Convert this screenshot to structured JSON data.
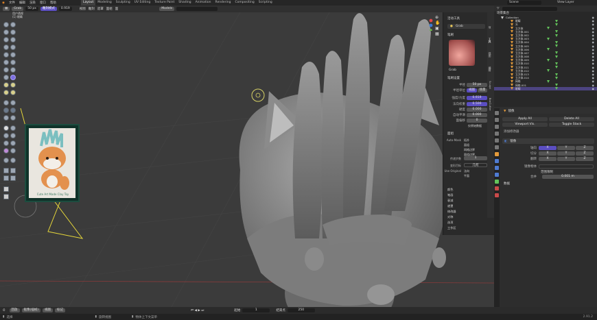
{
  "topbar": {
    "menus": [
      "文件",
      "编辑",
      "渲染",
      "窗口",
      "帮助"
    ],
    "workspaces": [
      "Layout",
      "Modeling",
      "Sculpting",
      "UV Editing",
      "Texture Paint",
      "Shading",
      "Animation",
      "Rendering",
      "Compositing",
      "Scripting"
    ],
    "active_workspace": "Layout",
    "scene": "Scene",
    "view_layer": "View Layer"
  },
  "viewport_header": {
    "mode": "雕刻模式",
    "brush": "Grab",
    "radius": "50 px",
    "strength": "0.919",
    "menus": [
      "视图",
      "雕刻",
      "遮罩",
      "面组",
      "面"
    ],
    "overlay_label": "Models",
    "view_name": "用户透视",
    "collection_name": "(1) 眼睛"
  },
  "outliner": {
    "items": [
      {
        "name": "Collection"
      },
      {
        "name": "眼睛"
      },
      {
        "name": "头"
      },
      {
        "name": "立方体"
      },
      {
        "name": "立方体.001"
      },
      {
        "name": "立方体.002"
      },
      {
        "name": "立方体.003"
      },
      {
        "name": "立方体.004"
      },
      {
        "name": "立方体.005"
      },
      {
        "name": "立方体.006"
      },
      {
        "name": "立方体.007"
      },
      {
        "name": "立方体.008"
      },
      {
        "name": "立方体.009"
      },
      {
        "name": "立方体.010"
      },
      {
        "name": "立方体.011"
      },
      {
        "name": "立方体.012"
      },
      {
        "name": "立方体.013"
      },
      {
        "name": "立方体.014"
      },
      {
        "name": "网格"
      },
      {
        "name": "网格.001"
      },
      {
        "name": "眼睛"
      }
    ],
    "selected_index": 20,
    "header_label": "场景集合"
  },
  "npanel": {
    "active_tool": "活动工具",
    "brush_section": "笔刷",
    "brush_name": "Grab",
    "brush_settings": "笔刷设置",
    "radius_label": "半径",
    "radius_value": "50 px",
    "radius_unit_label": "半径单位",
    "radius_unit_view": "视图",
    "radius_unit_scene": "场景",
    "strength_label": "强度/力度",
    "strength_value": "0.919",
    "normal_weight_label": "法向权重",
    "normal_weight_value": "0.500",
    "hardness_label": "硬度",
    "hardness_value": "0.000",
    "autosmooth_label": "自动平滑",
    "autosmooth_value": "0.000",
    "plane_offset_label": "面偏移",
    "plane_offset_value": "0",
    "sections": [
      "面组",
      "颜色",
      "笔画",
      "衰减",
      "遮罩",
      "修改器",
      "对称",
      "选项",
      "工作区"
    ],
    "auto_masking_label": "Auto-Mask",
    "mask_options": [
      "拓扑",
      "面组",
      "网格边界",
      "面组边界"
    ],
    "propagation_label": "传递步数",
    "propagation_value": "1",
    "deform_label": "变形目标",
    "deform_value": "几何",
    "use_original_label": "Use Original",
    "use_original_options": [
      "法向",
      "平面"
    ],
    "hide_original": "仅原始数据",
    "tabs": [
      "项",
      "工具",
      "视图",
      "编辑",
      "Sculpt",
      "BoxCutter"
    ]
  },
  "properties": {
    "section": "镜像",
    "apply_all": "Apply All",
    "delete_all": "Delete All",
    "viewport_vis": "Viewport Vis.",
    "toggle_stack": "Toggle Stack",
    "add_modifier": "添加修改器",
    "modifier_name": "镜像",
    "axis_label": "轴向",
    "bisect_label": "切分",
    "flip_label": "翻转",
    "axes": [
      "X",
      "Y",
      "Z"
    ],
    "mirror_object_label": "镜像物体",
    "clipping_label": "范围限制",
    "merge_label": "合并",
    "merge_value": "0.001 m",
    "data_label": "数据"
  },
  "timeline": {
    "labels": [
      "回放",
      "抠像(插帧)",
      "视图",
      "标记"
    ],
    "start_label": "起始",
    "start_value": "1",
    "end_label": "结束点",
    "end_value": "250"
  },
  "statusbar": {
    "left_text": "选择",
    "mid_text": "旋转视图",
    "right_text": "物体上下文菜单",
    "version": "2.91.2"
  },
  "reference": {
    "caption": "Cute Art Made Clay Toy"
  },
  "colors": {
    "accent": "#5b4ec1",
    "orange_object": "#e39a3b",
    "green_data": "#63c35b",
    "viewport": "#3b3b3b"
  }
}
